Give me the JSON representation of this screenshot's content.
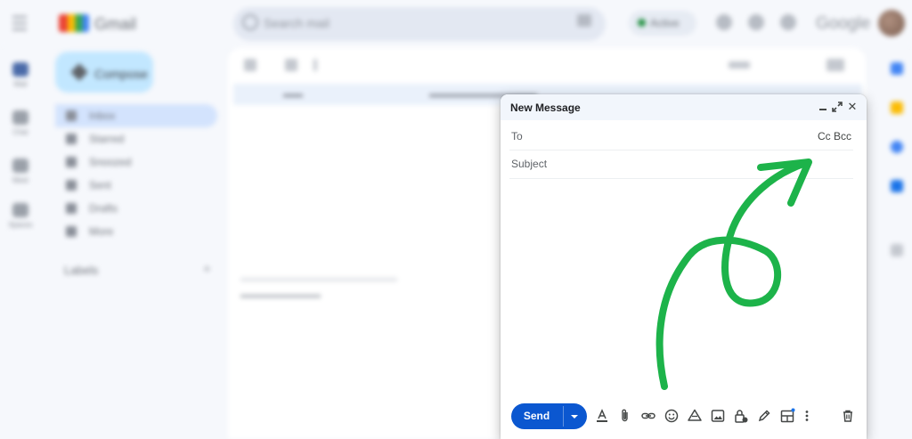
{
  "app": {
    "name": "Gmail",
    "search_placeholder": "Search mail",
    "status_label": "Active",
    "account_word": "Google"
  },
  "compose_button": {
    "label": "Compose"
  },
  "left_rail": [
    {
      "label": "Mail"
    },
    {
      "label": "Chat"
    },
    {
      "label": "Meet"
    },
    {
      "label": "Spaces"
    }
  ],
  "nav_items": [
    {
      "label": "Inbox",
      "active": true
    },
    {
      "label": "Starred"
    },
    {
      "label": "Snoozed"
    },
    {
      "label": "Sent"
    },
    {
      "label": "Drafts"
    },
    {
      "label": "More"
    }
  ],
  "labels_header": "Labels",
  "compose": {
    "title": "New Message",
    "to_label": "To",
    "cc_label": "Cc",
    "bcc_label": "Bcc",
    "subject_placeholder": "Subject",
    "send_label": "Send"
  },
  "toolbar_icons": [
    "text-format-icon",
    "attach-icon",
    "link-icon",
    "emoji-icon",
    "drive-icon",
    "photo-icon",
    "confidential-lock-icon",
    "signature-pen-icon",
    "layouts-icon",
    "more-options-icon",
    "discard-trash-icon"
  ],
  "annotation": {
    "color": "#1db34a",
    "kind": "hand-drawn-arrow",
    "points_to": "cc-bcc"
  },
  "colors": {
    "send": "#0b57d0",
    "compose_header": "#f2f6fc",
    "inbox_active": "#d3e3fd"
  }
}
